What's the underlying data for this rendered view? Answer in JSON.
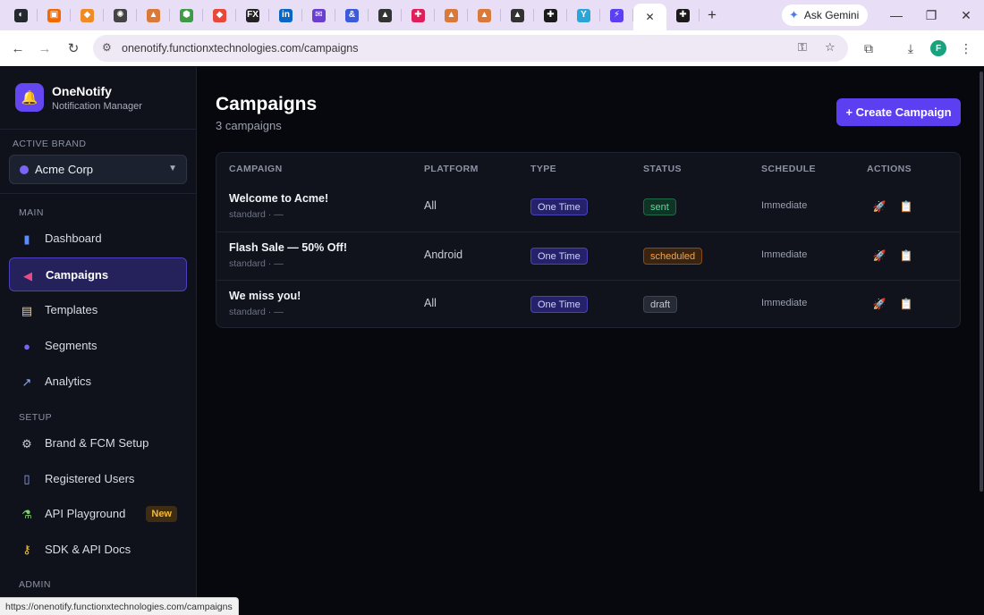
{
  "browser": {
    "tabs": [
      {
        "icon": "github-icon",
        "glyph": "◐",
        "bg": "#24292f"
      },
      {
        "icon": "grafana-icon",
        "glyph": "▣",
        "bg": "#f46800"
      },
      {
        "icon": "cube-icon",
        "glyph": "◆",
        "bg": "#f08a24"
      },
      {
        "icon": "chatgpt-icon",
        "glyph": "✺",
        "bg": "#444444"
      },
      {
        "icon": "mountain-icon",
        "glyph": "▲",
        "bg": "#d9793a"
      },
      {
        "icon": "nodejs-icon",
        "glyph": "⬢",
        "bg": "#3e9a47"
      },
      {
        "icon": "git-icon",
        "glyph": "◆",
        "bg": "#e8483a"
      },
      {
        "icon": "fx-icon",
        "glyph": "FX",
        "bg": "#222222"
      },
      {
        "icon": "linkedin-icon",
        "glyph": "in",
        "bg": "#0a66c2"
      },
      {
        "icon": "mail-icon",
        "glyph": "✉",
        "bg": "#6a3fd0"
      },
      {
        "icon": "ampersand-icon",
        "glyph": "&",
        "bg": "#3b5bdb"
      },
      {
        "icon": "graduation-icon",
        "glyph": "▲",
        "bg": "#333333"
      },
      {
        "icon": "slack-icon",
        "glyph": "✚",
        "bg": "#e01e5a"
      },
      {
        "icon": "mountain-icon",
        "glyph": "▲",
        "bg": "#d9793a"
      },
      {
        "icon": "mountain-icon",
        "glyph": "▲",
        "bg": "#d9793a"
      },
      {
        "icon": "graduation-icon",
        "glyph": "▲",
        "bg": "#333333"
      },
      {
        "icon": "cross-icon",
        "glyph": "✚",
        "bg": "#1a1a1a"
      },
      {
        "icon": "y-icon",
        "glyph": "Y",
        "bg": "#2aa5d8"
      },
      {
        "icon": "bolt-icon",
        "glyph": "⚡",
        "bg": "#5b3ff0"
      }
    ],
    "active_tab": {
      "icon": "close-icon",
      "glyph": "✕"
    },
    "after_tab": {
      "icon": "cross-icon",
      "glyph": "✚",
      "bg": "#1a1a1a"
    },
    "new_tab_glyph": "+",
    "gemini_label": "Ask Gemini",
    "url": "onenotify.functionxtechnologies.com/campaigns",
    "profile_initial": "F",
    "status_url": "https://onenotify.functionxtechnologies.com/campaigns"
  },
  "sidebar": {
    "app_name": "OneNotify",
    "app_subtitle": "Notification Manager",
    "logo_glyph": "🔔",
    "active_brand_label": "ACTIVE BRAND",
    "active_brand_value": "Acme Corp",
    "sections": {
      "main": "MAIN",
      "setup": "SETUP",
      "admin": "ADMIN"
    },
    "main_items": [
      {
        "key": "dashboard",
        "label": "Dashboard",
        "icon": "chart-icon",
        "glyph": "▮",
        "color": "#5a8cff"
      },
      {
        "key": "campaigns",
        "label": "Campaigns",
        "icon": "megaphone-icon",
        "glyph": "◀",
        "color": "#e84b8a"
      },
      {
        "key": "templates",
        "label": "Templates",
        "icon": "clipboard-icon",
        "glyph": "▤",
        "color": "#e8c9a0"
      },
      {
        "key": "segments",
        "label": "Segments",
        "icon": "users-icon",
        "glyph": "●",
        "color": "#7b63f5"
      },
      {
        "key": "analytics",
        "label": "Analytics",
        "icon": "trend-icon",
        "glyph": "↗",
        "color": "#8fb3ff"
      }
    ],
    "setup_items": [
      {
        "key": "brand-fcm",
        "label": "Brand & FCM Setup",
        "icon": "gear-icon",
        "glyph": "⚙",
        "color": "#c9cdd6"
      },
      {
        "key": "registered-users",
        "label": "Registered Users",
        "icon": "phone-icon",
        "glyph": "▯",
        "color": "#9aa7ff"
      },
      {
        "key": "api-playground",
        "label": "API Playground",
        "icon": "flask-icon",
        "glyph": "⚗",
        "color": "#7fd36b",
        "badge": "New"
      },
      {
        "key": "sdk-docs",
        "label": "SDK & API Docs",
        "icon": "key-icon",
        "glyph": "⚷",
        "color": "#f5c542"
      }
    ]
  },
  "main": {
    "title": "Campaigns",
    "subtitle": "3 campaigns",
    "create_button": "+ Create Campaign",
    "columns": [
      "CAMPAIGN",
      "PLATFORM",
      "TYPE",
      "STATUS",
      "SCHEDULE",
      "ACTIONS"
    ],
    "rows": [
      {
        "name": "Welcome to Acme!",
        "meta": "standard · —",
        "platform": "All",
        "type": "One Time",
        "status": "sent",
        "schedule": "Immediate"
      },
      {
        "name": "Flash Sale — 50% Off!",
        "meta": "standard · —",
        "platform": "Android",
        "type": "One Time",
        "status": "scheduled",
        "schedule": "Immediate"
      },
      {
        "name": "We miss you!",
        "meta": "standard · —",
        "platform": "All",
        "type": "One Time",
        "status": "draft",
        "schedule": "Immediate"
      }
    ],
    "actions": [
      {
        "icon": "rocket-icon",
        "glyph": "🚀"
      },
      {
        "icon": "clipboard-icon",
        "glyph": "📋"
      }
    ]
  },
  "colors": {
    "accent": "#5b3ff0",
    "sent": "#51e09b",
    "scheduled": "#f5a44a",
    "draft": "#c2c7d2"
  }
}
